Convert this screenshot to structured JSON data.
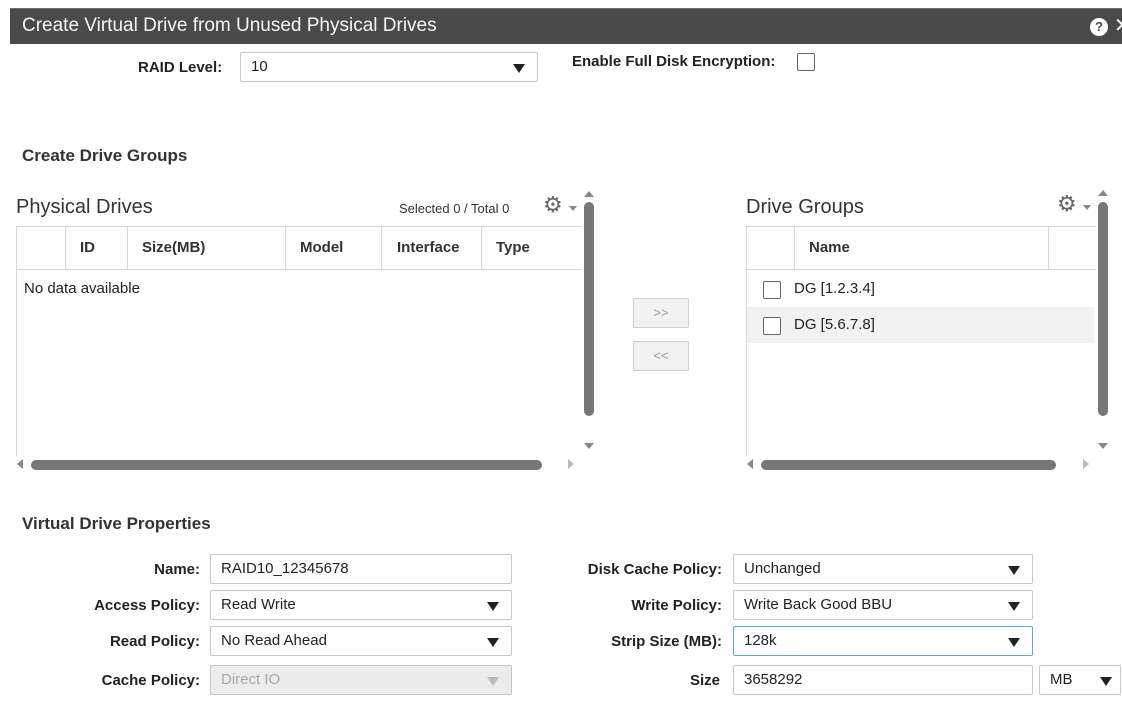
{
  "window": {
    "title": "Create Virtual Drive from Unused Physical Drives",
    "help_glyph": "?",
    "close_glyph": "✕"
  },
  "top": {
    "raid_label": "RAID Level:",
    "raid_value": "10",
    "encryption_label": "Enable Full Disk Encryption:",
    "encryption_checked": false
  },
  "drive_groups_section": {
    "title": "Create Drive Groups"
  },
  "physical_drives": {
    "title": "Physical Drives",
    "selection_status": "Selected 0 / Total 0",
    "columns": [
      "ID",
      "Size(MB)",
      "Model",
      "Interface",
      "Type"
    ],
    "empty_message": "No data available"
  },
  "move_buttons": {
    "add": ">>",
    "remove": "<<"
  },
  "drive_groups": {
    "title": "Drive Groups",
    "columns": [
      "Name"
    ],
    "rows": [
      {
        "name": "DG [1.2.3.4]",
        "checked": false
      },
      {
        "name": "DG [5.6.7.8]",
        "checked": false
      }
    ]
  },
  "vd_properties": {
    "title": "Virtual Drive Properties",
    "name_label": "Name:",
    "name_value": "RAID10_12345678",
    "access_label": "Access Policy:",
    "access_value": "Read Write",
    "read_label": "Read Policy:",
    "read_value": "No Read Ahead",
    "cache_label": "Cache Policy:",
    "cache_value": "Direct IO",
    "disk_cache_label": "Disk Cache Policy:",
    "disk_cache_value": "Unchanged",
    "write_label": "Write Policy:",
    "write_value": "Write Back Good BBU",
    "strip_label": "Strip Size (MB):",
    "strip_value": "128k",
    "size_label": "Size",
    "size_value": "3658292",
    "size_unit": "MB"
  },
  "colors": {
    "titlebar_bg": "#4a4a4a",
    "row_alt": "#f2f2f2",
    "focus_border": "#5aa7e0",
    "scroll_thumb": "#777777"
  },
  "icons": [
    "help-icon",
    "close-icon",
    "gear-icon",
    "chevron-down-icon",
    "scroll-up-icon",
    "scroll-down-icon",
    "scroll-left-icon",
    "scroll-right-icon"
  ]
}
